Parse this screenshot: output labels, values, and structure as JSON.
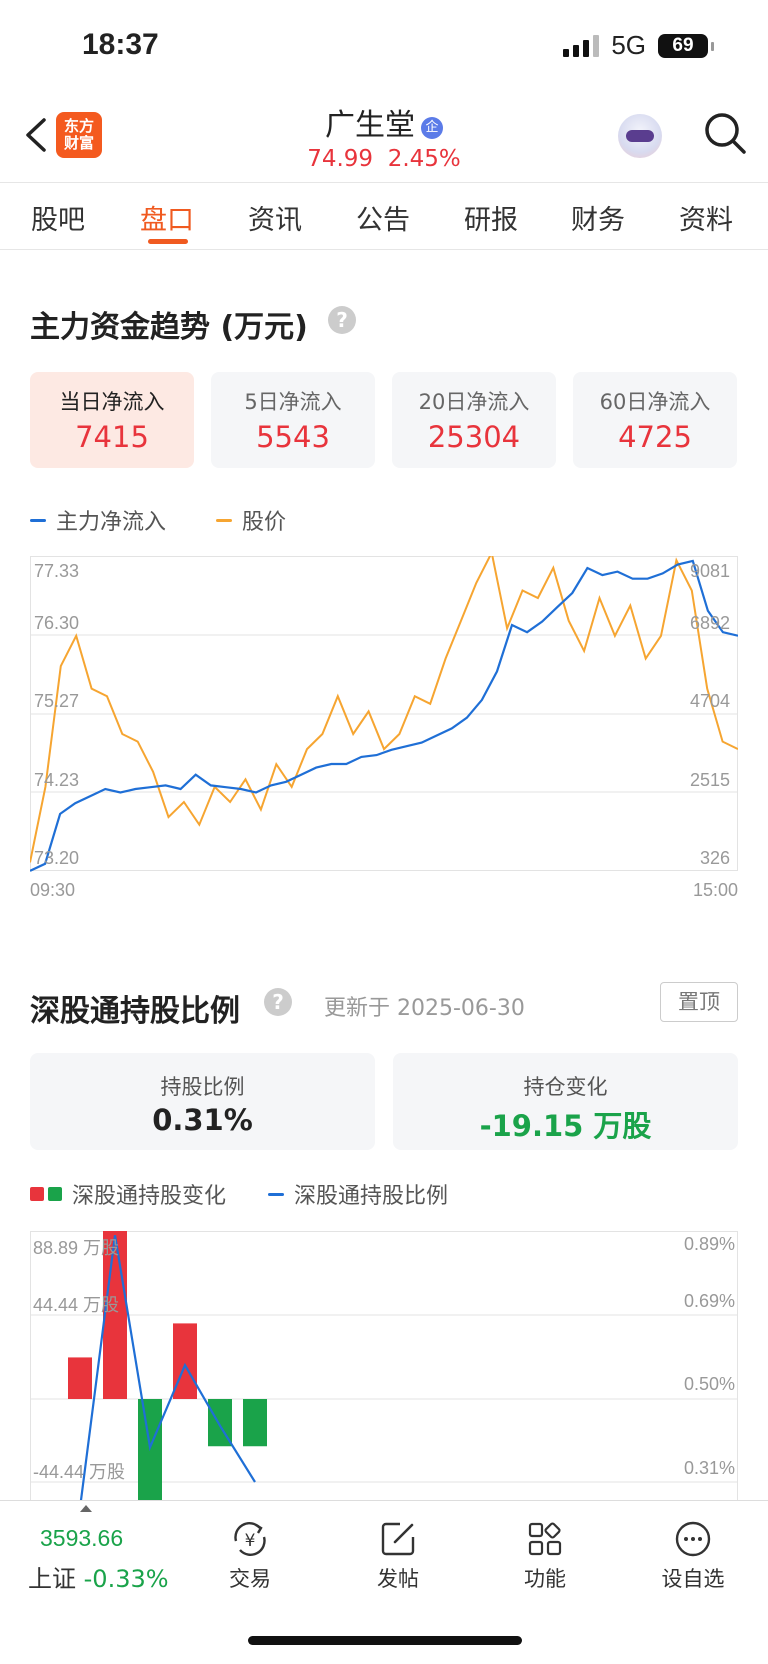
{
  "status_bar": {
    "time": "18:37",
    "network": "5G",
    "battery": "69"
  },
  "header": {
    "logo_line1": "东方",
    "logo_line2": "财富",
    "stock_name": "广生堂",
    "enterprise_badge": "企",
    "price": "74.99",
    "change_pct": "2.45%"
  },
  "tabs": [
    {
      "label": "股吧"
    },
    {
      "label": "盘口"
    },
    {
      "label": "资讯"
    },
    {
      "label": "公告"
    },
    {
      "label": "研报"
    },
    {
      "label": "财务"
    },
    {
      "label": "资料"
    }
  ],
  "active_tab": "盘口",
  "fund_flow": {
    "title": "主力资金趋势 (万元)",
    "help": "?",
    "cards": [
      {
        "label": "当日净流入",
        "value": "7415"
      },
      {
        "label": "5日净流入",
        "value": "5543"
      },
      {
        "label": "20日净流入",
        "value": "25304"
      },
      {
        "label": "60日净流入",
        "value": "4725"
      }
    ],
    "legend": {
      "inflow": "主力净流入",
      "price": "股价"
    },
    "x_start": "09:30",
    "x_end": "15:00",
    "left_ticks": [
      "77.33",
      "76.30",
      "75.27",
      "74.23",
      "73.20"
    ],
    "right_ticks": [
      "9081",
      "6892",
      "4704",
      "2515",
      "326"
    ]
  },
  "shenzhen_connect": {
    "title": "深股通持股比例",
    "help": "?",
    "updated": "更新于 2025-06-30",
    "pin_label": "置顶",
    "holding_ratio_label": "持股比例",
    "holding_ratio_value": "0.31%",
    "position_change_label": "持仓变化",
    "position_change_value": "-19.15 万股",
    "legend_change": "深股通持股变化",
    "legend_ratio": "深股通持股比例",
    "left_ticks": [
      "88.89 万股",
      "44.44 万股",
      "-44.44 万股"
    ],
    "right_ticks": [
      "0.89%",
      "0.69%",
      "0.50%",
      "0.31%"
    ]
  },
  "bottom_nav": {
    "index_value": "3593.66",
    "index_name": "上证",
    "index_change": "-0.33%",
    "items": [
      {
        "label": "交易"
      },
      {
        "label": "发帖"
      },
      {
        "label": "功能"
      },
      {
        "label": "设自选"
      }
    ]
  },
  "colors": {
    "accent": "#f05a20",
    "up": "#e8343c",
    "down": "#1aa34a",
    "line_blue": "#1f6fd6",
    "line_orange": "#f6a531"
  },
  "chart_data": [
    {
      "type": "line",
      "x_range": [
        "09:30",
        "15:00"
      ],
      "left_axis_range": [
        73.2,
        77.33
      ],
      "right_axis_range": [
        326,
        9081
      ],
      "series": [
        {
          "name": "主力净流入",
          "axis": "right",
          "values": [
            300,
            500,
            1900,
            2200,
            2400,
            2600,
            2500,
            2600,
            2650,
            2700,
            2600,
            3000,
            2700,
            2650,
            2600,
            2500,
            2700,
            2800,
            3000,
            3200,
            3300,
            3300,
            3500,
            3550,
            3700,
            3800,
            3900,
            4100,
            4300,
            4600,
            5100,
            5900,
            7200,
            7000,
            7300,
            7700,
            8100,
            8800,
            8600,
            8700,
            8500,
            8500,
            8650,
            8900,
            9000,
            7600,
            7000,
            6900
          ]
        },
        {
          "name": "股价",
          "axis": "left",
          "values": [
            73.3,
            74.3,
            75.9,
            76.3,
            75.6,
            75.5,
            75.0,
            74.9,
            74.5,
            73.9,
            74.1,
            73.8,
            74.3,
            74.1,
            74.4,
            74.0,
            74.6,
            74.3,
            74.8,
            75.0,
            75.5,
            75.0,
            75.3,
            74.8,
            75.0,
            75.5,
            75.4,
            76.0,
            76.5,
            77.0,
            77.4,
            76.4,
            76.9,
            76.8,
            77.2,
            76.5,
            76.1,
            76.8,
            76.3,
            76.7,
            76.0,
            76.3,
            77.3,
            76.9,
            75.6,
            74.9,
            74.8
          ]
        }
      ]
    },
    {
      "type": "bar",
      "series": [
        {
          "name": "深股通持股变化",
          "values": [
            22,
            133,
            -70,
            40,
            -25,
            -25
          ]
        },
        {
          "name": "深股通持股比例",
          "values": [
            0.25,
            0.88,
            0.39,
            0.58,
            0.44,
            0.31
          ]
        }
      ],
      "left_axis_range": [
        -88.89,
        88.89
      ],
      "right_axis_range": [
        0.12,
        0.89
      ]
    }
  ]
}
